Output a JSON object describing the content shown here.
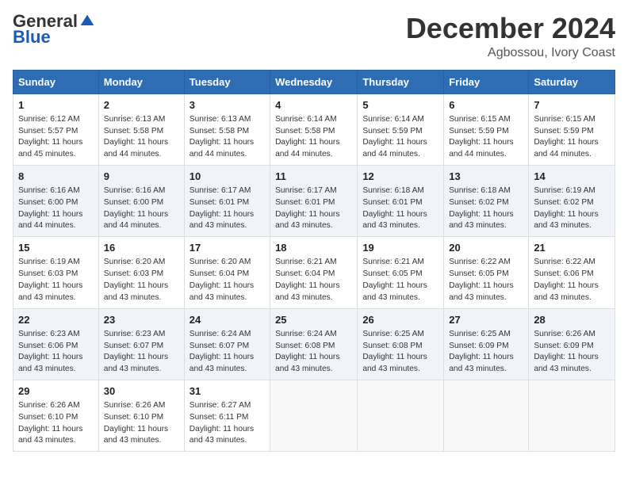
{
  "header": {
    "logo_general": "General",
    "logo_blue": "Blue",
    "month_title": "December 2024",
    "location": "Agbossou, Ivory Coast"
  },
  "days_of_week": [
    "Sunday",
    "Monday",
    "Tuesday",
    "Wednesday",
    "Thursday",
    "Friday",
    "Saturday"
  ],
  "weeks": [
    [
      {
        "day": "1",
        "sunrise": "6:12 AM",
        "sunset": "5:57 PM",
        "daylight": "11 hours and 45 minutes."
      },
      {
        "day": "2",
        "sunrise": "6:13 AM",
        "sunset": "5:58 PM",
        "daylight": "11 hours and 44 minutes."
      },
      {
        "day": "3",
        "sunrise": "6:13 AM",
        "sunset": "5:58 PM",
        "daylight": "11 hours and 44 minutes."
      },
      {
        "day": "4",
        "sunrise": "6:14 AM",
        "sunset": "5:58 PM",
        "daylight": "11 hours and 44 minutes."
      },
      {
        "day": "5",
        "sunrise": "6:14 AM",
        "sunset": "5:59 PM",
        "daylight": "11 hours and 44 minutes."
      },
      {
        "day": "6",
        "sunrise": "6:15 AM",
        "sunset": "5:59 PM",
        "daylight": "11 hours and 44 minutes."
      },
      {
        "day": "7",
        "sunrise": "6:15 AM",
        "sunset": "5:59 PM",
        "daylight": "11 hours and 44 minutes."
      }
    ],
    [
      {
        "day": "8",
        "sunrise": "6:16 AM",
        "sunset": "6:00 PM",
        "daylight": "11 hours and 44 minutes."
      },
      {
        "day": "9",
        "sunrise": "6:16 AM",
        "sunset": "6:00 PM",
        "daylight": "11 hours and 44 minutes."
      },
      {
        "day": "10",
        "sunrise": "6:17 AM",
        "sunset": "6:01 PM",
        "daylight": "11 hours and 43 minutes."
      },
      {
        "day": "11",
        "sunrise": "6:17 AM",
        "sunset": "6:01 PM",
        "daylight": "11 hours and 43 minutes."
      },
      {
        "day": "12",
        "sunrise": "6:18 AM",
        "sunset": "6:01 PM",
        "daylight": "11 hours and 43 minutes."
      },
      {
        "day": "13",
        "sunrise": "6:18 AM",
        "sunset": "6:02 PM",
        "daylight": "11 hours and 43 minutes."
      },
      {
        "day": "14",
        "sunrise": "6:19 AM",
        "sunset": "6:02 PM",
        "daylight": "11 hours and 43 minutes."
      }
    ],
    [
      {
        "day": "15",
        "sunrise": "6:19 AM",
        "sunset": "6:03 PM",
        "daylight": "11 hours and 43 minutes."
      },
      {
        "day": "16",
        "sunrise": "6:20 AM",
        "sunset": "6:03 PM",
        "daylight": "11 hours and 43 minutes."
      },
      {
        "day": "17",
        "sunrise": "6:20 AM",
        "sunset": "6:04 PM",
        "daylight": "11 hours and 43 minutes."
      },
      {
        "day": "18",
        "sunrise": "6:21 AM",
        "sunset": "6:04 PM",
        "daylight": "11 hours and 43 minutes."
      },
      {
        "day": "19",
        "sunrise": "6:21 AM",
        "sunset": "6:05 PM",
        "daylight": "11 hours and 43 minutes."
      },
      {
        "day": "20",
        "sunrise": "6:22 AM",
        "sunset": "6:05 PM",
        "daylight": "11 hours and 43 minutes."
      },
      {
        "day": "21",
        "sunrise": "6:22 AM",
        "sunset": "6:06 PM",
        "daylight": "11 hours and 43 minutes."
      }
    ],
    [
      {
        "day": "22",
        "sunrise": "6:23 AM",
        "sunset": "6:06 PM",
        "daylight": "11 hours and 43 minutes."
      },
      {
        "day": "23",
        "sunrise": "6:23 AM",
        "sunset": "6:07 PM",
        "daylight": "11 hours and 43 minutes."
      },
      {
        "day": "24",
        "sunrise": "6:24 AM",
        "sunset": "6:07 PM",
        "daylight": "11 hours and 43 minutes."
      },
      {
        "day": "25",
        "sunrise": "6:24 AM",
        "sunset": "6:08 PM",
        "daylight": "11 hours and 43 minutes."
      },
      {
        "day": "26",
        "sunrise": "6:25 AM",
        "sunset": "6:08 PM",
        "daylight": "11 hours and 43 minutes."
      },
      {
        "day": "27",
        "sunrise": "6:25 AM",
        "sunset": "6:09 PM",
        "daylight": "11 hours and 43 minutes."
      },
      {
        "day": "28",
        "sunrise": "6:26 AM",
        "sunset": "6:09 PM",
        "daylight": "11 hours and 43 minutes."
      }
    ],
    [
      {
        "day": "29",
        "sunrise": "6:26 AM",
        "sunset": "6:10 PM",
        "daylight": "11 hours and 43 minutes."
      },
      {
        "day": "30",
        "sunrise": "6:26 AM",
        "sunset": "6:10 PM",
        "daylight": "11 hours and 43 minutes."
      },
      {
        "day": "31",
        "sunrise": "6:27 AM",
        "sunset": "6:11 PM",
        "daylight": "11 hours and 43 minutes."
      },
      null,
      null,
      null,
      null
    ]
  ],
  "labels": {
    "sunrise_prefix": "Sunrise: ",
    "sunset_prefix": "Sunset: ",
    "daylight_prefix": "Daylight: "
  }
}
